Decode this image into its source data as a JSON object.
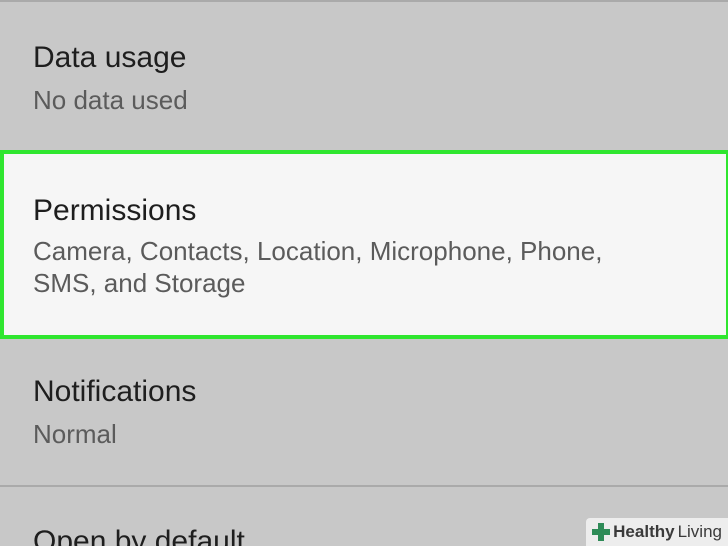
{
  "settings": {
    "items": [
      {
        "title": "Data usage",
        "subtitle": "No data used"
      },
      {
        "title": "Permissions",
        "subtitle": "Camera, Contacts, Location, Microphone, Phone, SMS, and Storage"
      },
      {
        "title": "Notifications",
        "subtitle": "Normal"
      },
      {
        "title": "Open by default",
        "subtitle": ""
      }
    ]
  },
  "highlight": {
    "color": "#2fe62f"
  },
  "watermark": {
    "brand_part1": "Healthy",
    "brand_part2": "Living",
    "icon": "plus-cross-icon"
  }
}
